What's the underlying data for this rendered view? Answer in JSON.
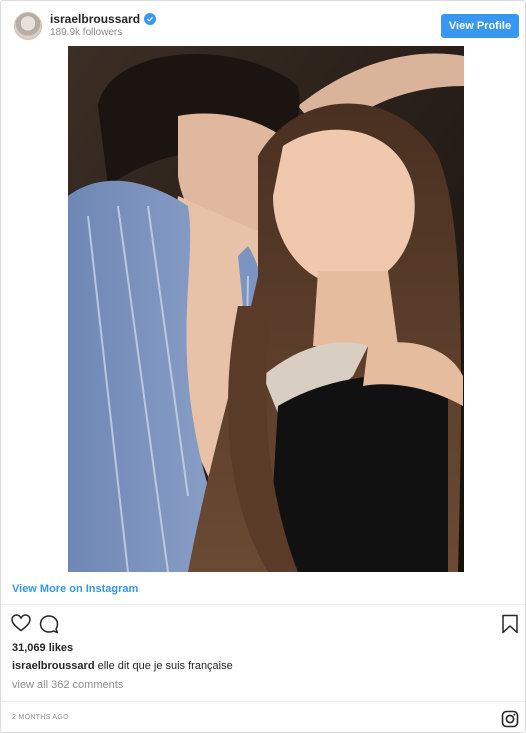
{
  "header": {
    "username": "israelbroussard",
    "followers": "189.9k followers",
    "view_profile_label": "View Profile",
    "verified_icon": "verified-badge-icon",
    "accent_color": "#3897f0"
  },
  "view_more_label": "View More on Instagram",
  "actions": {
    "like_icon": "heart-icon",
    "comment_icon": "comment-icon",
    "save_icon": "bookmark-icon"
  },
  "likes": "31,069 likes",
  "caption": {
    "username": "israelbroussard",
    "text": "elle dit que je suis française"
  },
  "comments_link": "view all 362 comments",
  "timestamp": "2 MONTHS AGO",
  "footer_icon": "instagram-logo-icon"
}
